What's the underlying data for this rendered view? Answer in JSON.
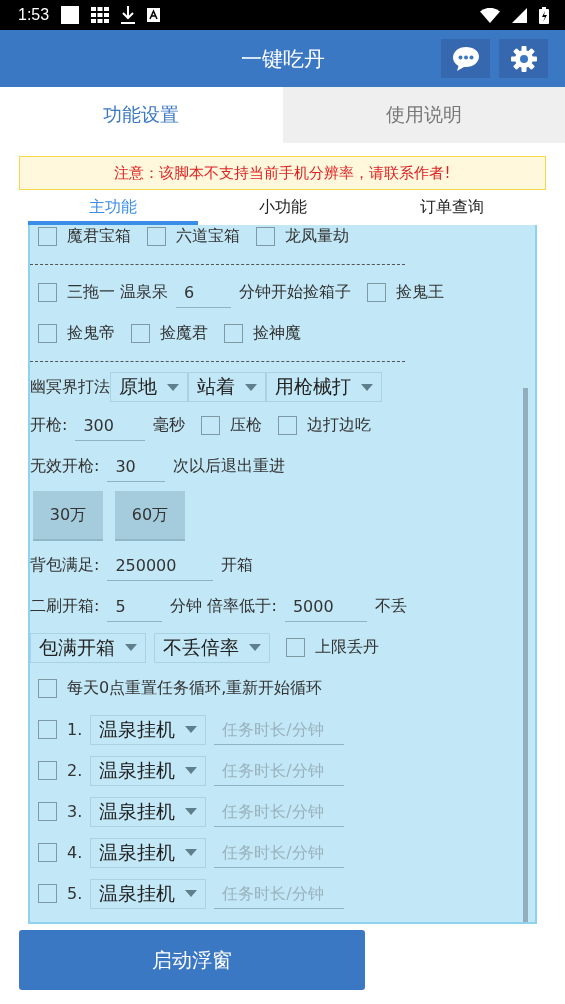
{
  "status_bar": {
    "time": "1:53"
  },
  "app_bar": {
    "title": "一键吃丹"
  },
  "tabs": [
    {
      "label": "功能设置",
      "selected": true
    },
    {
      "label": "使用说明",
      "selected": false
    }
  ],
  "warning": "注意：该脚本不支持当前手机分辨率，请联系作者!",
  "sub_tabs": [
    {
      "label": "主功能",
      "selected": true
    },
    {
      "label": "小功能",
      "selected": false
    },
    {
      "label": "订单查询",
      "selected": false
    }
  ],
  "rows": [
    {
      "kind": "row",
      "items": [
        {
          "kind": "checkbox",
          "label": "魔君宝箱",
          "checked": false
        },
        {
          "kind": "checkbox",
          "label": "六道宝箱",
          "checked": false
        },
        {
          "kind": "checkbox",
          "label": "龙凤量劫",
          "checked": false
        }
      ]
    },
    {
      "kind": "divider"
    },
    {
      "kind": "row",
      "items": [
        {
          "kind": "checkbox",
          "label": "三拖一 温泉呆",
          "checked": false
        },
        {
          "kind": "input",
          "value": "6"
        },
        {
          "kind": "text",
          "text": "分钟开始捡箱子"
        },
        {
          "kind": "checkbox",
          "label": "捡鬼王",
          "checked": false
        }
      ]
    },
    {
      "kind": "row",
      "items": [
        {
          "kind": "checkbox",
          "label": "捡鬼帝",
          "checked": false
        },
        {
          "kind": "checkbox",
          "label": "捡魔君",
          "checked": false
        },
        {
          "kind": "checkbox",
          "label": "捡神魔",
          "checked": false
        }
      ]
    },
    {
      "kind": "divider"
    },
    {
      "kind": "tight",
      "items": [
        {
          "kind": "text",
          "text": "幽冥界打法"
        },
        {
          "kind": "dropdown",
          "value": "原地"
        },
        {
          "kind": "dropdown",
          "value": "站着"
        },
        {
          "kind": "dropdown",
          "value": "用枪械打"
        }
      ]
    },
    {
      "kind": "row",
      "items": [
        {
          "kind": "text",
          "text": "开枪:"
        },
        {
          "kind": "input",
          "value": "300"
        },
        {
          "kind": "text",
          "text": "毫秒"
        },
        {
          "kind": "checkbox",
          "label": "压枪",
          "checked": false
        },
        {
          "kind": "checkbox",
          "label": "边打边吃",
          "checked": false
        }
      ]
    },
    {
      "kind": "row",
      "items": [
        {
          "kind": "text",
          "text": "无效开枪:"
        },
        {
          "kind": "input",
          "value": "30"
        },
        {
          "kind": "text",
          "text": "次以后退出重进"
        }
      ]
    },
    {
      "kind": "tall",
      "items": [
        {
          "kind": "button",
          "label": "30万"
        },
        {
          "kind": "button",
          "label": "60万"
        }
      ]
    },
    {
      "kind": "row",
      "items": [
        {
          "kind": "text",
          "text": "背包满足:"
        },
        {
          "kind": "input",
          "value": "250000"
        },
        {
          "kind": "text",
          "text": "开箱"
        }
      ]
    },
    {
      "kind": "row",
      "items": [
        {
          "kind": "text",
          "text": "二刷开箱:"
        },
        {
          "kind": "input",
          "value": "5"
        },
        {
          "kind": "text",
          "text": "分钟  倍率低于:"
        },
        {
          "kind": "input",
          "value": "5000"
        },
        {
          "kind": "text",
          "text": "不丢"
        }
      ]
    },
    {
      "kind": "row",
      "items": [
        {
          "kind": "dropdown",
          "value": "包满开箱"
        },
        {
          "kind": "dropdown",
          "value": "不丢倍率"
        },
        {
          "kind": "checkbox",
          "label": "上限丢丹",
          "checked": false
        }
      ]
    },
    {
      "kind": "row",
      "items": [
        {
          "kind": "checkbox",
          "label": "每天0点重置任务循环,重新开始循环",
          "checked": false
        }
      ]
    },
    {
      "kind": "row",
      "items": [
        {
          "kind": "checkbox",
          "label": "1.",
          "checked": false
        },
        {
          "kind": "dropdown",
          "value": "温泉挂机"
        },
        {
          "kind": "input",
          "placeholder": "任务时长/分钟"
        }
      ]
    },
    {
      "kind": "row",
      "items": [
        {
          "kind": "checkbox",
          "label": "2.",
          "checked": false
        },
        {
          "kind": "dropdown",
          "value": "温泉挂机"
        },
        {
          "kind": "input",
          "placeholder": "任务时长/分钟"
        }
      ]
    },
    {
      "kind": "row",
      "items": [
        {
          "kind": "checkbox",
          "label": "3.",
          "checked": false
        },
        {
          "kind": "dropdown",
          "value": "温泉挂机"
        },
        {
          "kind": "input",
          "placeholder": "任务时长/分钟"
        }
      ]
    },
    {
      "kind": "row",
      "items": [
        {
          "kind": "checkbox",
          "label": "4.",
          "checked": false
        },
        {
          "kind": "dropdown",
          "value": "温泉挂机"
        },
        {
          "kind": "input",
          "placeholder": "任务时长/分钟"
        }
      ]
    },
    {
      "kind": "row",
      "items": [
        {
          "kind": "checkbox",
          "label": "5.",
          "checked": false
        },
        {
          "kind": "dropdown",
          "value": "温泉挂机"
        },
        {
          "kind": "input",
          "placeholder": "任务时长/分钟"
        }
      ]
    }
  ],
  "start_button": "启动浮窗"
}
